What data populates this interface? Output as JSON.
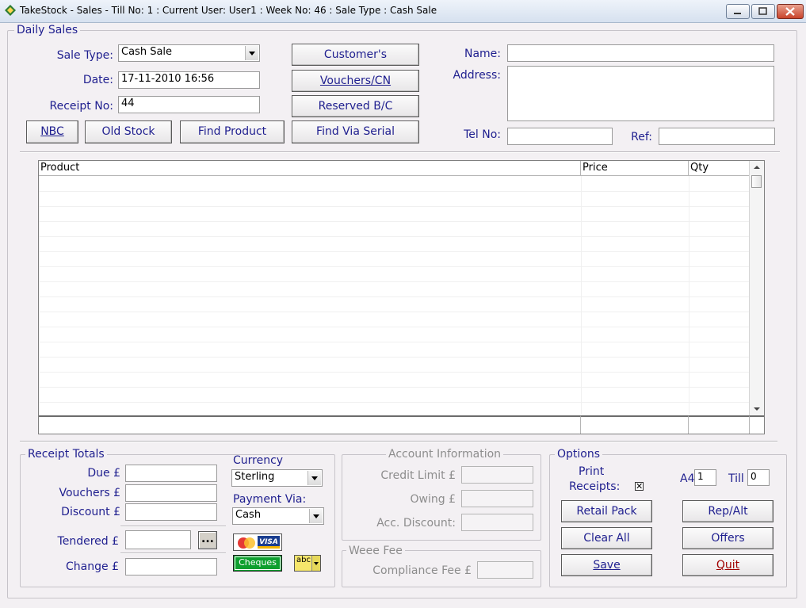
{
  "window": {
    "title": "TakeStock - Sales - Till No: 1 : Current User: User1 : Week No: 46 : Sale Type : Cash Sale"
  },
  "daily_sales": {
    "group_title": "Daily Sales",
    "sale_type_label": "Sale Type:",
    "sale_type_value": "Cash Sale",
    "date_label": "Date:",
    "date_value": "17-11-2010 16:56",
    "receipt_label": "Receipt No:",
    "receipt_value": "44",
    "buttons": {
      "customers": "Customer's",
      "vouchers": "Vouchers/CN",
      "reserved": "Reserved B/C",
      "nbc": "NBC",
      "old_stock": "Old Stock",
      "find_product": "Find Product",
      "find_serial": "Find Via Serial"
    },
    "name_label": "Name:",
    "address_label": "Address:",
    "tel_label": "Tel No:",
    "ref_label": "Ref:"
  },
  "grid": {
    "columns": [
      "Product",
      "Price",
      "Qty"
    ],
    "rows": []
  },
  "receipt_totals": {
    "group_title": "Receipt Totals",
    "due_label": "Due £",
    "vouchers_label": "Vouchers £",
    "discount_label": "Discount £",
    "tendered_label": "Tendered £",
    "ellipsis": "...",
    "change_label": "Change £",
    "currency_label": "Currency",
    "currency_value": "Sterling",
    "payment_label": "Payment Via:",
    "payment_value": "Cash",
    "visa_text": "VISA",
    "cheques_text": "Cheques",
    "abc_text": "abc"
  },
  "account": {
    "group_title": "Account Information",
    "credit_limit_label": "Credit Limit £",
    "owing_label": "Owing £",
    "acc_discount_label": "Acc. Discount:"
  },
  "weee": {
    "group_title": "Weee Fee",
    "compliance_label": "Compliance Fee £"
  },
  "options": {
    "group_title": "Options",
    "print_label_1": "Print",
    "print_label_2": "Receipts:",
    "print_checked": "✕",
    "a4_label": "A4",
    "a4_value": "1",
    "till_label": "Till",
    "till_value": "0",
    "buttons": {
      "retail_pack": "Retail Pack",
      "rep_alt": "Rep/Alt",
      "clear_all": "Clear All",
      "offers": "Offers",
      "save": "Save",
      "quit": "Quit"
    }
  },
  "colors": {
    "label": "#1f1f8f",
    "quit": "#a00000",
    "background": "#f3f0f3"
  }
}
